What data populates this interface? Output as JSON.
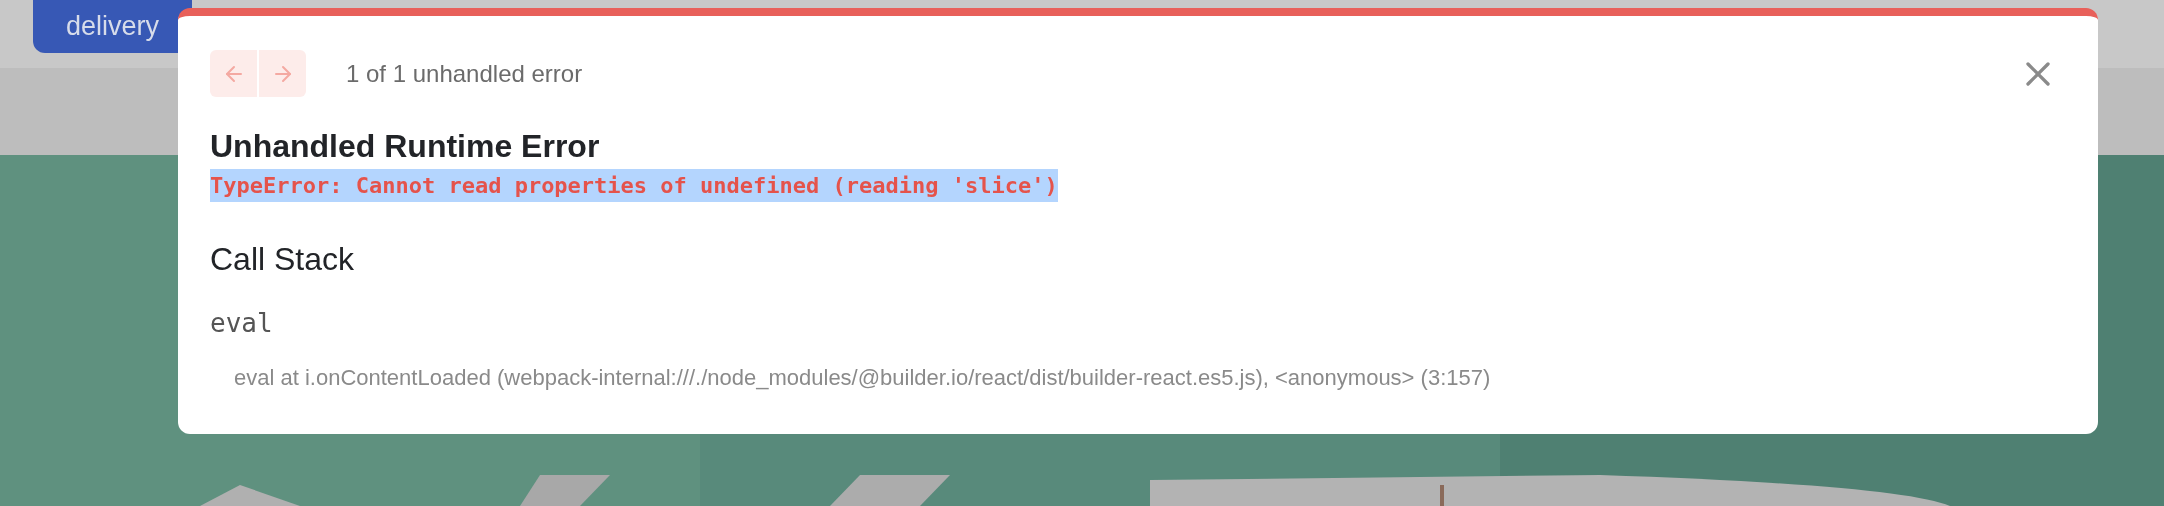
{
  "background": {
    "button": "delivery"
  },
  "dialog": {
    "nav": [
      {
        "kind": "prev",
        "disabled": true
      },
      {
        "kind": "next",
        "disabled": true
      }
    ],
    "counter": "1 of 1 unhandled error",
    "title": "Unhandled Runtime Error",
    "message": {
      "text": "TypeError: Cannot read properties of undefined (reading 'slice')",
      "highlighted": true
    },
    "call_stack": {
      "heading": "Call Stack",
      "frames": [
        {
          "function": "eval",
          "location": "eval at i.onContentLoaded (webpack-internal:///./node_modules/@builder.io/react/dist/builder-react.es5.js), <anonymous> (3:157)"
        }
      ]
    }
  }
}
